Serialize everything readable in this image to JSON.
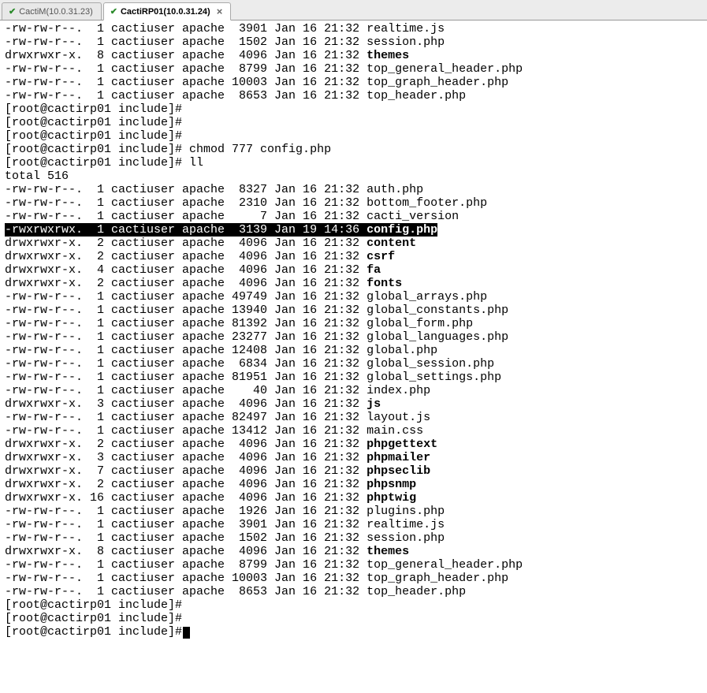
{
  "tabs": [
    {
      "label": "CactiM(10.0.31.23)",
      "active": false
    },
    {
      "label": "CactiRP01(10.0.31.24)",
      "active": true
    }
  ],
  "prompt": "[root@cactirp01 include]#",
  "commands": {
    "chmod": "chmod 777 config.php",
    "ll": "ll",
    "total": "total 516"
  },
  "top_listing": [
    {
      "perm": "-rw-rw-r--.",
      "links": "1",
      "user": "cactiuser",
      "group": "apache",
      "size": "3901",
      "date": "Jan 16 21:32",
      "name": "realtime.js",
      "bold": false
    },
    {
      "perm": "-rw-rw-r--.",
      "links": "1",
      "user": "cactiuser",
      "group": "apache",
      "size": "1502",
      "date": "Jan 16 21:32",
      "name": "session.php",
      "bold": false
    },
    {
      "perm": "drwxrwxr-x.",
      "links": "8",
      "user": "cactiuser",
      "group": "apache",
      "size": "4096",
      "date": "Jan 16 21:32",
      "name": "themes",
      "bold": true
    },
    {
      "perm": "-rw-rw-r--.",
      "links": "1",
      "user": "cactiuser",
      "group": "apache",
      "size": "8799",
      "date": "Jan 16 21:32",
      "name": "top_general_header.php",
      "bold": false
    },
    {
      "perm": "-rw-rw-r--.",
      "links": "1",
      "user": "cactiuser",
      "group": "apache",
      "size": "10003",
      "date": "Jan 16 21:32",
      "name": "top_graph_header.php",
      "bold": false
    },
    {
      "perm": "-rw-rw-r--.",
      "links": "1",
      "user": "cactiuser",
      "group": "apache",
      "size": "8653",
      "date": "Jan 16 21:32",
      "name": "top_header.php",
      "bold": false
    }
  ],
  "listing": [
    {
      "perm": "-rw-rw-r--.",
      "links": "1",
      "user": "cactiuser",
      "group": "apache",
      "size": "8327",
      "date": "Jan 16 21:32",
      "name": "auth.php",
      "bold": false,
      "hl": false
    },
    {
      "perm": "-rw-rw-r--.",
      "links": "1",
      "user": "cactiuser",
      "group": "apache",
      "size": "2310",
      "date": "Jan 16 21:32",
      "name": "bottom_footer.php",
      "bold": false,
      "hl": false
    },
    {
      "perm": "-rw-rw-r--.",
      "links": "1",
      "user": "cactiuser",
      "group": "apache",
      "size": "7",
      "date": "Jan 16 21:32",
      "name": "cacti_version",
      "bold": false,
      "hl": false
    },
    {
      "perm": "-rwxrwxrwx.",
      "links": "1",
      "user": "cactiuser",
      "group": "apache",
      "size": "3139",
      "date": "Jan 19 14:36",
      "name": "config.php",
      "bold": true,
      "hl": true
    },
    {
      "perm": "drwxrwxr-x.",
      "links": "2",
      "user": "cactiuser",
      "group": "apache",
      "size": "4096",
      "date": "Jan 16 21:32",
      "name": "content",
      "bold": true,
      "hl": false
    },
    {
      "perm": "drwxrwxr-x.",
      "links": "2",
      "user": "cactiuser",
      "group": "apache",
      "size": "4096",
      "date": "Jan 16 21:32",
      "name": "csrf",
      "bold": true,
      "hl": false
    },
    {
      "perm": "drwxrwxr-x.",
      "links": "4",
      "user": "cactiuser",
      "group": "apache",
      "size": "4096",
      "date": "Jan 16 21:32",
      "name": "fa",
      "bold": true,
      "hl": false
    },
    {
      "perm": "drwxrwxr-x.",
      "links": "2",
      "user": "cactiuser",
      "group": "apache",
      "size": "4096",
      "date": "Jan 16 21:32",
      "name": "fonts",
      "bold": true,
      "hl": false
    },
    {
      "perm": "-rw-rw-r--.",
      "links": "1",
      "user": "cactiuser",
      "group": "apache",
      "size": "49749",
      "date": "Jan 16 21:32",
      "name": "global_arrays.php",
      "bold": false,
      "hl": false
    },
    {
      "perm": "-rw-rw-r--.",
      "links": "1",
      "user": "cactiuser",
      "group": "apache",
      "size": "13940",
      "date": "Jan 16 21:32",
      "name": "global_constants.php",
      "bold": false,
      "hl": false
    },
    {
      "perm": "-rw-rw-r--.",
      "links": "1",
      "user": "cactiuser",
      "group": "apache",
      "size": "81392",
      "date": "Jan 16 21:32",
      "name": "global_form.php",
      "bold": false,
      "hl": false
    },
    {
      "perm": "-rw-rw-r--.",
      "links": "1",
      "user": "cactiuser",
      "group": "apache",
      "size": "23277",
      "date": "Jan 16 21:32",
      "name": "global_languages.php",
      "bold": false,
      "hl": false
    },
    {
      "perm": "-rw-rw-r--.",
      "links": "1",
      "user": "cactiuser",
      "group": "apache",
      "size": "12408",
      "date": "Jan 16 21:32",
      "name": "global.php",
      "bold": false,
      "hl": false
    },
    {
      "perm": "-rw-rw-r--.",
      "links": "1",
      "user": "cactiuser",
      "group": "apache",
      "size": "6834",
      "date": "Jan 16 21:32",
      "name": "global_session.php",
      "bold": false,
      "hl": false
    },
    {
      "perm": "-rw-rw-r--.",
      "links": "1",
      "user": "cactiuser",
      "group": "apache",
      "size": "81951",
      "date": "Jan 16 21:32",
      "name": "global_settings.php",
      "bold": false,
      "hl": false
    },
    {
      "perm": "-rw-rw-r--.",
      "links": "1",
      "user": "cactiuser",
      "group": "apache",
      "size": "40",
      "date": "Jan 16 21:32",
      "name": "index.php",
      "bold": false,
      "hl": false
    },
    {
      "perm": "drwxrwxr-x.",
      "links": "3",
      "user": "cactiuser",
      "group": "apache",
      "size": "4096",
      "date": "Jan 16 21:32",
      "name": "js",
      "bold": true,
      "hl": false
    },
    {
      "perm": "-rw-rw-r--.",
      "links": "1",
      "user": "cactiuser",
      "group": "apache",
      "size": "82497",
      "date": "Jan 16 21:32",
      "name": "layout.js",
      "bold": false,
      "hl": false
    },
    {
      "perm": "-rw-rw-r--.",
      "links": "1",
      "user": "cactiuser",
      "group": "apache",
      "size": "13412",
      "date": "Jan 16 21:32",
      "name": "main.css",
      "bold": false,
      "hl": false
    },
    {
      "perm": "drwxrwxr-x.",
      "links": "2",
      "user": "cactiuser",
      "group": "apache",
      "size": "4096",
      "date": "Jan 16 21:32",
      "name": "phpgettext",
      "bold": true,
      "hl": false
    },
    {
      "perm": "drwxrwxr-x.",
      "links": "3",
      "user": "cactiuser",
      "group": "apache",
      "size": "4096",
      "date": "Jan 16 21:32",
      "name": "phpmailer",
      "bold": true,
      "hl": false
    },
    {
      "perm": "drwxrwxr-x.",
      "links": "7",
      "user": "cactiuser",
      "group": "apache",
      "size": "4096",
      "date": "Jan 16 21:32",
      "name": "phpseclib",
      "bold": true,
      "hl": false
    },
    {
      "perm": "drwxrwxr-x.",
      "links": "2",
      "user": "cactiuser",
      "group": "apache",
      "size": "4096",
      "date": "Jan 16 21:32",
      "name": "phpsnmp",
      "bold": true,
      "hl": false
    },
    {
      "perm": "drwxrwxr-x.",
      "links": "16",
      "user": "cactiuser",
      "group": "apache",
      "size": "4096",
      "date": "Jan 16 21:32",
      "name": "phptwig",
      "bold": true,
      "hl": false
    },
    {
      "perm": "-rw-rw-r--.",
      "links": "1",
      "user": "cactiuser",
      "group": "apache",
      "size": "1926",
      "date": "Jan 16 21:32",
      "name": "plugins.php",
      "bold": false,
      "hl": false
    },
    {
      "perm": "-rw-rw-r--.",
      "links": "1",
      "user": "cactiuser",
      "group": "apache",
      "size": "3901",
      "date": "Jan 16 21:32",
      "name": "realtime.js",
      "bold": false,
      "hl": false
    },
    {
      "perm": "-rw-rw-r--.",
      "links": "1",
      "user": "cactiuser",
      "group": "apache",
      "size": "1502",
      "date": "Jan 16 21:32",
      "name": "session.php",
      "bold": false,
      "hl": false
    },
    {
      "perm": "drwxrwxr-x.",
      "links": "8",
      "user": "cactiuser",
      "group": "apache",
      "size": "4096",
      "date": "Jan 16 21:32",
      "name": "themes",
      "bold": true,
      "hl": false
    },
    {
      "perm": "-rw-rw-r--.",
      "links": "1",
      "user": "cactiuser",
      "group": "apache",
      "size": "8799",
      "date": "Jan 16 21:32",
      "name": "top_general_header.php",
      "bold": false,
      "hl": false
    },
    {
      "perm": "-rw-rw-r--.",
      "links": "1",
      "user": "cactiuser",
      "group": "apache",
      "size": "10003",
      "date": "Jan 16 21:32",
      "name": "top_graph_header.php",
      "bold": false,
      "hl": false
    },
    {
      "perm": "-rw-rw-r--.",
      "links": "1",
      "user": "cactiuser",
      "group": "apache",
      "size": "8653",
      "date": "Jan 16 21:32",
      "name": "top_header.php",
      "bold": false,
      "hl": false
    }
  ]
}
